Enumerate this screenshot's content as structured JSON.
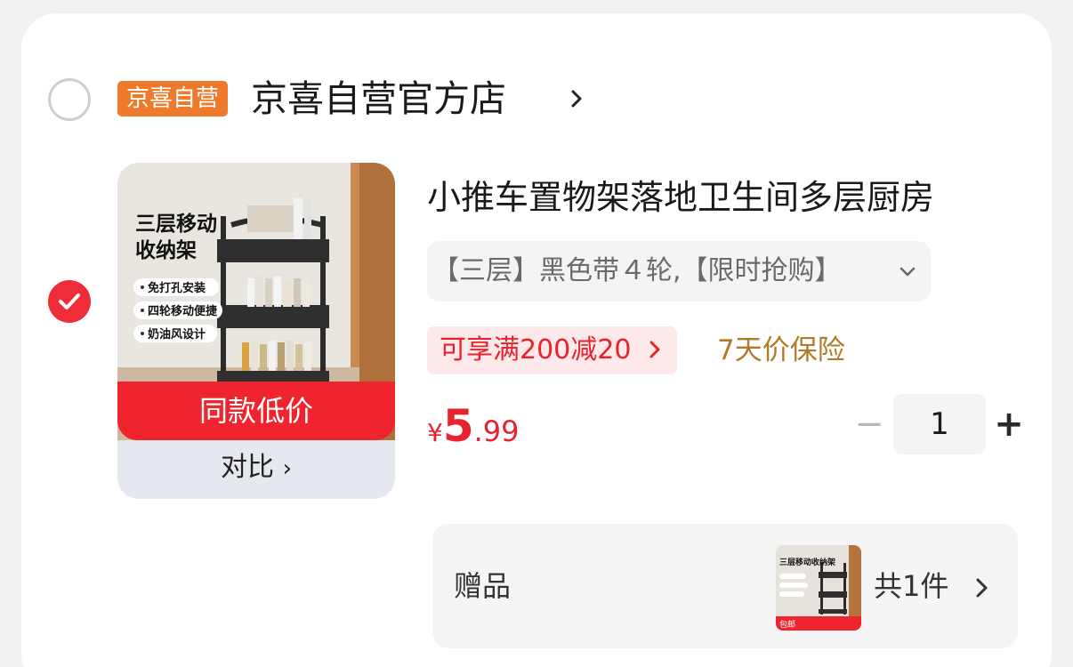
{
  "shop": {
    "badge": "京喜自营",
    "name": "京喜自营官方店",
    "selected": false
  },
  "item": {
    "selected": true,
    "image": {
      "poster_title_line1": "三层移动",
      "poster_title_line2": "收纳架",
      "poster_features": [
        "免打孔安装",
        "四轮移动便捷",
        "奶油风设计"
      ],
      "banner": "同款低价",
      "compare_label": "对比",
      "compare_chevron": "›"
    },
    "title": "小推车置物架落地卫生间多层厨房",
    "spec": "【三层】黑色带４轮,【限时抢购】",
    "promo": "可享满200减20",
    "insurance": "7天价保险",
    "price": {
      "currency": "¥",
      "integer": "5",
      "decimal": ".99"
    },
    "quantity": "1",
    "minus_label": "−",
    "plus_label": "+"
  },
  "gift": {
    "label": "赠品",
    "count": "共1件",
    "thumb_title": "三层移动收纳架",
    "thumb_badge": "包邮"
  },
  "colors": {
    "accent_red": "#e8232e",
    "badge_orange": "#f07a2c",
    "insurance_gold": "#b07a2a"
  }
}
